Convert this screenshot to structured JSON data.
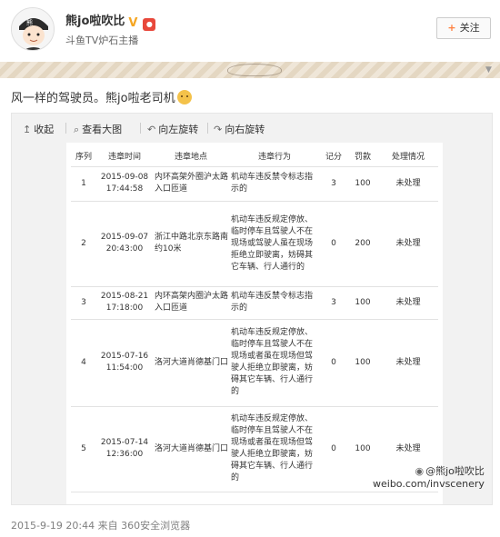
{
  "header": {
    "username": "熊jo啦吹比",
    "verify_icon": "v-verified-icon",
    "subtitle": "斗鱼TV炉石主播",
    "follow_label": "关注"
  },
  "post": {
    "text": "风一样的驾驶员。熊jo啦老司机",
    "emoji": "dog-emoji"
  },
  "toolbar": {
    "collapse": "收起",
    "view_large": "查看大图",
    "rotate_left": "向左旋转",
    "rotate_right": "向右旋转"
  },
  "table": {
    "headers": [
      "序列",
      "违章时间",
      "违章地点",
      "违章行为",
      "记分",
      "罚款",
      "处理情况"
    ],
    "rows": [
      {
        "no": "1",
        "time": "2015-09-08 17:44:58",
        "place": "内环高架外圈沪太路入口匝道",
        "act": "机动车违反禁令标志指示的",
        "points": "3",
        "fine": "100",
        "status": "未处理"
      },
      {
        "no": "2",
        "time": "2015-09-07 20:43:00",
        "place": "浙江中路北京东路南约10米",
        "act": "机动车违反规定停放、临时停车且驾驶人不在现场或驾驶人虽在现场拒绝立即驶离，妨碍其它车辆、行人通行的",
        "points": "0",
        "fine": "200",
        "status": "未处理"
      },
      {
        "no": "3",
        "time": "2015-08-21 17:18:00",
        "place": "内环高架内圈沪太路入口匝道",
        "act": "机动车违反禁令标志指示的",
        "points": "3",
        "fine": "100",
        "status": "未处理"
      },
      {
        "no": "4",
        "time": "2015-07-16 11:54:00",
        "place": "洛河大道肖德基门口",
        "act": "机动车违反规定停放、临时停车且驾驶人不在现场或者虽在现场但驾驶人拒绝立即驶离，妨碍其它车辆、行人通行的",
        "points": "0",
        "fine": "100",
        "status": "未处理"
      },
      {
        "no": "5",
        "time": "2015-07-14 12:36:00",
        "place": "洛河大道肖德基门口",
        "act": "机动车违反规定停放、临时停车且驾驶人不在现场或者虽在现场但驾驶人拒绝立即驶离，妨碍其它车辆、行人通行的",
        "points": "0",
        "fine": "100",
        "status": "未处理"
      }
    ]
  },
  "watermark": {
    "line1": "@熊jo啦吹比",
    "line2": "weibo.com/invscenery"
  },
  "footer": {
    "meta": "2015-9-19 20:44 来自 360安全浏览器"
  },
  "colors": {
    "accent": "#ff8140",
    "verify": "#f5a623",
    "link": "#eb7350"
  }
}
